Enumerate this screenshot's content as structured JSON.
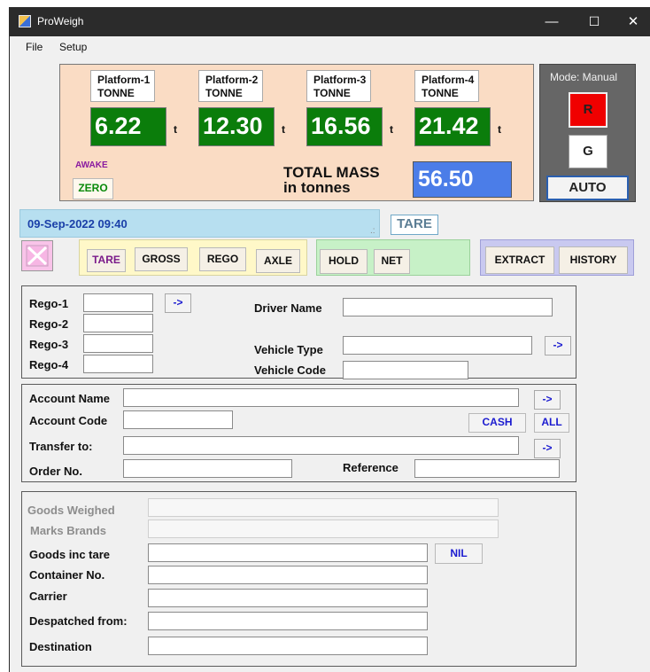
{
  "app": {
    "title": "ProWeigh"
  },
  "window": {
    "minimize": "—",
    "maximize": "☐",
    "close": "✕"
  },
  "menu": [
    "File",
    "Setup"
  ],
  "platforms": [
    {
      "name": "Platform-1",
      "unit_label": "TONNE",
      "value": "6.22",
      "unit": "t"
    },
    {
      "name": "Platform-2",
      "unit_label": "TONNE",
      "value": "12.30",
      "unit": "t"
    },
    {
      "name": "Platform-3",
      "unit_label": "TONNE",
      "value": "16.56",
      "unit": "t"
    },
    {
      "name": "Platform-4",
      "unit_label": "TONNE",
      "value": "21.42",
      "unit": "t"
    }
  ],
  "status": {
    "awake": "AWAKE",
    "zero": "ZERO"
  },
  "total": {
    "label1": "TOTAL MASS",
    "label2": "in tonnes",
    "value": "56.50"
  },
  "mode": {
    "label": "Mode: Manual",
    "r": "R",
    "g": "G",
    "auto": "AUTO"
  },
  "datetime": "09-Sep-2022  09:40",
  "weigh_state": "TARE",
  "buttons": {
    "tare": "TARE",
    "gross": "GROSS",
    "rego": "REGO",
    "axle": "AXLE",
    "hold": "HOLD",
    "net": "NET",
    "extract": "EXTRACT",
    "history": "HISTORY"
  },
  "vehicle": {
    "rego1": "Rego-1",
    "rego2": "Rego-2",
    "rego3": "Rego-3",
    "rego4": "Rego-4",
    "driver": "Driver Name",
    "vtype": "Vehicle Type",
    "vcode": "Vehicle Code",
    "arrow": "->"
  },
  "account": {
    "name": "Account Name",
    "code": "Account Code",
    "transfer": "Transfer to:",
    "order": "Order No.",
    "reference": "Reference",
    "cash": "CASH",
    "all": "ALL",
    "arrow": "->"
  },
  "goods": {
    "weighed": "Goods Weighed",
    "marks": "Marks  Brands",
    "inc_tare": "Goods inc tare",
    "container": "Container No.",
    "carrier": "Carrier",
    "despatched": "Despatched from:",
    "destination": "Destination",
    "nil": "NIL"
  },
  "colors": {
    "platform_bg": "#fadcc4",
    "value_green": "#0b7d0b",
    "total_blue": "#4b7de8",
    "mode_panel": "#666666",
    "red": "#f00000",
    "date_bar": "#b7dff0",
    "tare_group": "#fff8c8",
    "hold_group": "#c7f1c7",
    "extract_group": "#c9c9f0"
  }
}
